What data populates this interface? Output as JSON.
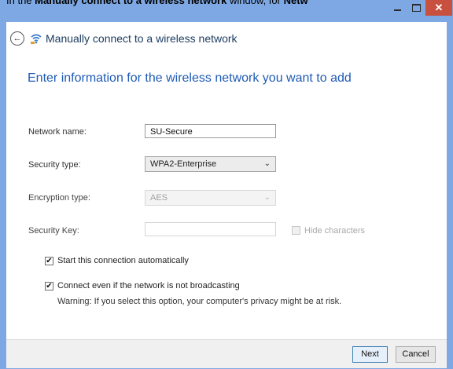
{
  "caption": {
    "prefix": "In the ",
    "bold": "Manually connect to a wireless network",
    "suffix": " window, for ",
    "bold2": "Netw"
  },
  "window": {
    "title": "Manually connect to a wireless network",
    "controls": {
      "close_glyph": "✕"
    },
    "accent_color": "#7ea8e4"
  },
  "nav": {
    "back_glyph": "←"
  },
  "form": {
    "heading": "Enter information for the wireless network you want to add",
    "network_name": {
      "label": "Network name:",
      "value": "SU-Secure"
    },
    "security_type": {
      "label": "Security type:",
      "value": "WPA2-Enterprise"
    },
    "encryption_type": {
      "label": "Encryption type:",
      "value": "AES"
    },
    "security_key": {
      "label": "Security Key:",
      "value": ""
    },
    "hide_characters": {
      "label": "Hide characters",
      "checked": false
    },
    "start_auto": {
      "label": "Start this connection automatically",
      "checked": true
    },
    "connect_hidden": {
      "label": "Connect even if the network is not broadcasting",
      "checked": true
    },
    "warning": "Warning: If you select this option, your computer's privacy might be at risk."
  },
  "buttons": {
    "next": "Next",
    "cancel": "Cancel"
  },
  "glyphs": {
    "check": "✔",
    "dropdown": "⌄"
  }
}
